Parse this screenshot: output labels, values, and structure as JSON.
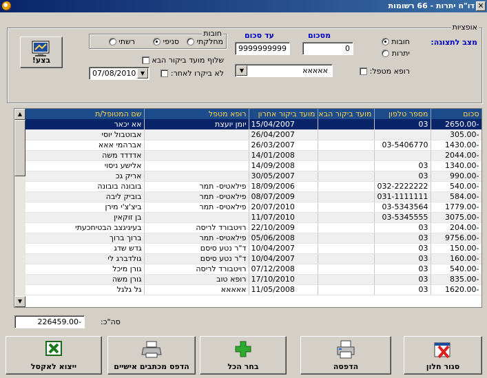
{
  "window": {
    "title": "דו\"ח יתרות - 66 רשומות",
    "close_glyph": "✕"
  },
  "options": {
    "legend": "אופציות",
    "display_mode_label": "מצב לתצוגה:",
    "debts_label": "חובות",
    "balances_label": "יתרות",
    "amount_label": "מסכום",
    "amount_value": "0",
    "to_amount_label": "עד סכום",
    "to_amount_value": "9999999999",
    "debts_group_legend": "חובות",
    "radio_department": "מחלקתי",
    "radio_branch": "סניפי",
    "radio_network": "רשתי",
    "send_next_visit_label": "שלוף מועד ביקור הבא",
    "no_visit_after_label": "לא ביקרו לאחר:",
    "no_visit_after_date": "07/08/2010",
    "treating_doctor_label": "רופא מטפל:",
    "treating_doctor_value": "אאאאא",
    "execute_label": "בצע!"
  },
  "table": {
    "columns": [
      "שם המטופל/ת",
      "רופא מטפל",
      "מועד ביקור אחרון",
      "מועד ביקור הבא",
      "מספר טלפון",
      "סכום"
    ],
    "rows": [
      [
        "אא יכאר",
        "יומן יועצת",
        "15/04/2007",
        "",
        "03",
        "2650.00-"
      ],
      [
        "אבוטבול יוסי",
        "",
        "26/04/2007",
        "",
        "",
        "305.00-"
      ],
      [
        "אברהמי אאא",
        "",
        "26/03/2007",
        "",
        "03-5406770",
        "1430.00-"
      ],
      [
        "אדדדד משה",
        "",
        "14/01/2008",
        "",
        "",
        "2044.00-"
      ],
      [
        "אלישע ניסוי",
        "",
        "14/09/2008",
        "",
        "03",
        "1340.00-"
      ],
      [
        "אריק גכ",
        "",
        "30/05/2007",
        "",
        "03",
        "990.00-"
      ],
      [
        "בובונה בובונה",
        "פילאטיס- תמר",
        "18/09/2006",
        "",
        "032-2222222",
        "540.00-"
      ],
      [
        "בוביק ליבה",
        "פילאטיס- תמר",
        "08/07/2009",
        "",
        "031-1111111",
        "584.00-"
      ],
      [
        "ביצ'צ'י מירן",
        "פילאטיס- תמר",
        "20/07/2010",
        "",
        "03-5343564",
        "1779.00-"
      ],
      [
        "בן זוקאין",
        "",
        "11/07/2010",
        "",
        "03-5345555",
        "3075.00-"
      ],
      [
        "בעיגיגצב הבטיחכעתי",
        "רויטבורד לריסה",
        "22/10/2009",
        "",
        "03",
        "204.00-"
      ],
      [
        "ברוך ברוך",
        "פילאטיס- תמר",
        "05/06/2008",
        "",
        "03",
        "9756.00-"
      ],
      [
        "גדש שדג",
        "ד\"ר נטע סיסם",
        "10/04/2007",
        "",
        "03",
        "150.00-"
      ],
      [
        "גולדברג לי",
        "ד\"ר נטע סיסם",
        "10/04/2007",
        "",
        "03",
        "160.00-"
      ],
      [
        "גורן מיכל",
        "רויטבורד לריסה",
        "07/12/2008",
        "",
        "03",
        "540.00-"
      ],
      [
        "גורן משה",
        "רופא טוב",
        "17/10/2010",
        "",
        "03",
        "835.00-"
      ],
      [
        "גל גלגל",
        "אאאאא",
        "11/05/2008",
        "",
        "03",
        "1620.00-"
      ]
    ]
  },
  "totals": {
    "label": "סה\"כ:",
    "value": "226459.00-"
  },
  "buttons": {
    "close": "סגור חלון",
    "print": "הדפסה",
    "select_all": "בחר הכל",
    "print_letters": "הדפס מכתבים אישיים",
    "export_excel": "ייצוא לאקסל"
  },
  "colors": {
    "header_bg": "#1c4c8c",
    "header_text": "#ffd34f",
    "selected_row": "#0a246a",
    "title_label": "#0000c0"
  }
}
